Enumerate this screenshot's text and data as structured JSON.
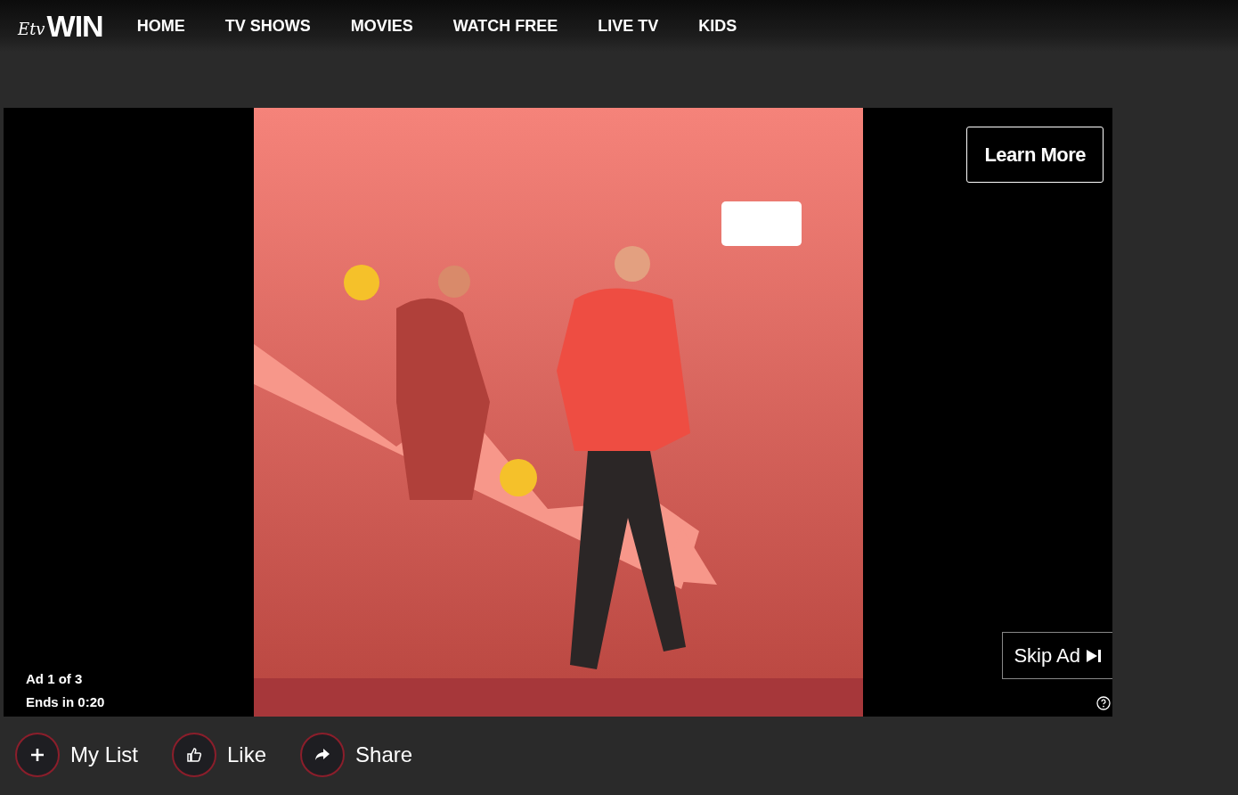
{
  "logo": {
    "script": "Etv",
    "word": "WIN"
  },
  "nav": [
    {
      "label": "HOME"
    },
    {
      "label": "TV SHOWS"
    },
    {
      "label": "MOVIES"
    },
    {
      "label": "WATCH FREE"
    },
    {
      "label": "LIVE TV"
    },
    {
      "label": "KIDS"
    }
  ],
  "player": {
    "learn_more": "Learn More",
    "skip": "Skip Ad",
    "ad_count": "Ad 1 of 3",
    "ends": "Ends in 0:20"
  },
  "actions": [
    {
      "label": "My List",
      "kind": "plus"
    },
    {
      "label": "Like",
      "kind": "thumb"
    },
    {
      "label": "Share",
      "kind": "share"
    }
  ]
}
